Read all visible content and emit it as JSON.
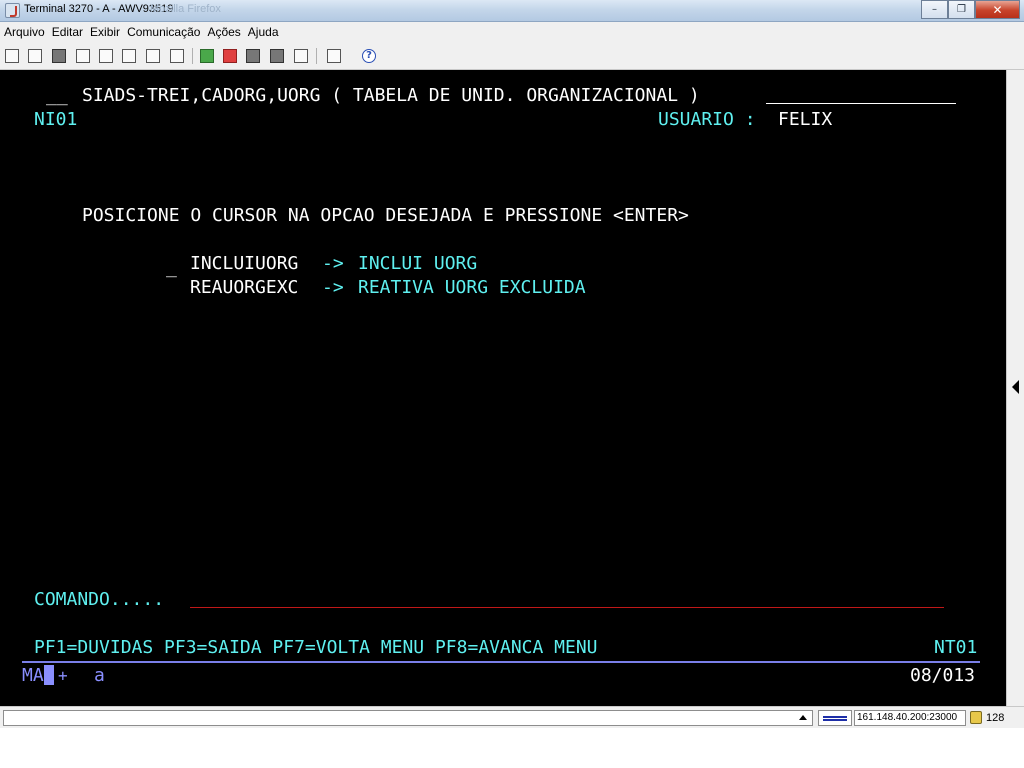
{
  "window": {
    "title": "Terminal 3270 - A - AWV93519",
    "ghost_title": "Mozilla Firefox"
  },
  "menu": [
    {
      "label": "Arquivo"
    },
    {
      "label": "Editar"
    },
    {
      "label": "Exibir"
    },
    {
      "label": "Comunicação"
    },
    {
      "label": "Ações"
    },
    {
      "label": "Ajuda"
    }
  ],
  "toolbar": {
    "icons": [
      "new-session-icon",
      "open-icon",
      "transfer-icon",
      "copy-icon",
      "paste-icon",
      "print-icon",
      "macro-icon",
      "keypad-icon",
      "play-icon",
      "record-icon",
      "stop-icon",
      "pause-icon",
      "send-icon",
      "receive-icon",
      "help-icon"
    ]
  },
  "screen": {
    "header_prefix": "__",
    "header_title": "SIADS-TREI,CADORG,UORG ( TABELA DE UNID. ORGANIZACIONAL )",
    "screen_id": "NI01",
    "user_label": "USUARIO :",
    "user_value": "FELIX",
    "instruction": "POSICIONE O CURSOR NA OPCAO DESEJADA E PRESSIONE <ENTER>",
    "options": [
      {
        "code": "INCLUIUORG",
        "arrow": "->",
        "desc": "INCLUI UORG"
      },
      {
        "code": "REAUORGEXC",
        "arrow": "->",
        "desc": "REATIVA UORG EXCLUIDA"
      }
    ],
    "option_cursor": "_",
    "command_label": "COMANDO.....",
    "pf_keys": "PF1=DUVIDAS PF3=SAIDA PF7=VOLTA MENU PF8=AVANCA MENU",
    "screen_code": "NT01",
    "oia": {
      "mode": "MA",
      "plus": "+",
      "indicator": "a",
      "cursor_pos": "08/013"
    }
  },
  "statusbar": {
    "host": "161.148.40.200:23000",
    "bits": "128"
  },
  "colors": {
    "screen_bg": "#000000",
    "text_white": "#ffffff",
    "text_cyan": "#5ff0f0",
    "command_line": "#c01818",
    "oia_rule": "#7a7fe8"
  }
}
